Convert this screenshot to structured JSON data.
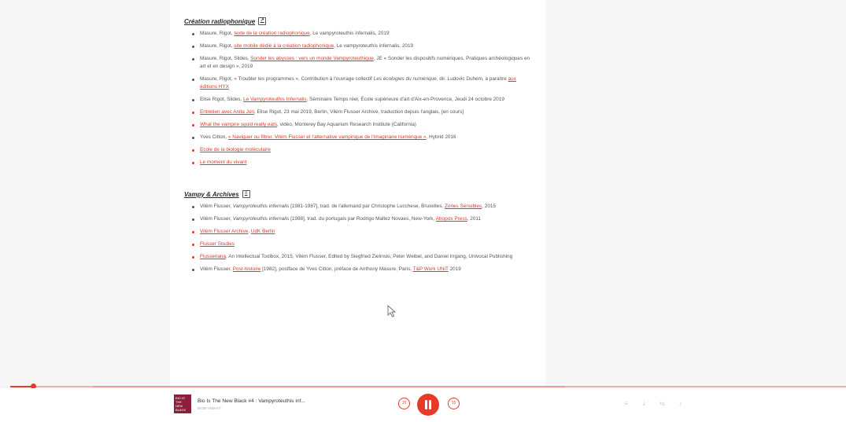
{
  "section1": {
    "title": "Création radiophonique",
    "items": [
      {
        "pre": "Masure, Rigot, ",
        "link": "texte de la création radiophonique",
        "post": ", Le vampyroteuthis infernalis, 2019"
      },
      {
        "pre": "Masure, Rigot, ",
        "link": "site mobile dédié à la création radiophonique",
        "post": ", Le vampyroteuthis infernalis, 2019"
      },
      {
        "pre": "Masure, Rigot, Slides, ",
        "link": "Sonder les abysses : vers un monde Vampyroteuthique",
        "post": ", JE « Sonder les dispositifs numériques. Pratiques archéologiques en art et en design », 2019"
      },
      {
        "pre": "Masure, Rigot, « Troubler les programmes », Contribution à l'ouvrage collectif ",
        "italic": "Les écologies du numérique",
        "mid": ", dir. Ludovic Duhem, à paraître ",
        "link": "aux éditions HYX",
        "post": ""
      },
      {
        "pre": "Elise Rigot, Slides, ",
        "link": "Le Vampyroteuthis Infernalis",
        "post": ", Séminaire Temps réel, École supérieure d'art d'Aix-en-Provence, Jeudi 24 octobre 2019"
      },
      {
        "pre": "",
        "link": "Entretien avec Anita Jori",
        "post": ", Elise Rigot, 23 mai 2019, Berlin, Vilém Flusser Archive, traduction depuis l'anglais, [en cours]"
      },
      {
        "pre": "",
        "link": "What the vampire squid really eats",
        "post": ", vidéo, Monterey Bay Aquarium Research Institute (California)"
      },
      {
        "pre": "Yves Citton, ",
        "link": "« Naviguer ou filtrer. Vilém Flusser et l'alternative vampirique de l'imaginaire numérique »",
        "post": ", Hybrid 2016"
      },
      {
        "pre": "",
        "link": "Ecole de la biologie moléculaire",
        "post": ""
      },
      {
        "pre": "",
        "link": "Le moment du vivant",
        "post": ""
      }
    ]
  },
  "section2": {
    "title": "Vampy & Archives",
    "items": [
      {
        "pre": "Vilém Flusser, ",
        "italic": "Vampyroteuthis infernalis",
        "mid": " [1981-1987], trad. de l'allemand par Christophe Lucchese, Bruxelles, ",
        "link": "Zones Sensibles",
        "post": ", 2015"
      },
      {
        "pre": "Vilém Flusser, ",
        "italic": "Vampyroteuthis infernalis",
        "mid": " [1988], trad. du portugais par Rodrigo Maltez Novaes, New-York, ",
        "link": "Atropos Press",
        "post": ", 2011"
      },
      {
        "pre": "",
        "link": "Vilém Flusser Archive",
        "post": ", ",
        "link2": "UdK Berlin"
      },
      {
        "pre": "",
        "link": "Flusser Studies",
        "post": ""
      },
      {
        "pre": "",
        "link": "Flusseriana",
        "post": ", An Intellectual Toolbox, 2015, Vilém Flusser, Edited by Siegfried Zielinski, Peter Weibel, and Daniel Irrgang, Univocal Publishing"
      },
      {
        "pre": "Vilém Flusser, ",
        "link": "Post-histoire",
        "post": " [1982], postface de Yves Citton, préface de Anthony Masure, Paris, ",
        "link2": "T&P Work UNiT",
        "post2": " 2019"
      }
    ]
  },
  "player": {
    "track_title": "Bio Is The New Black #4 : Vampyroteuthis inf...",
    "track_subtitle": "BIOB-VNM-KT",
    "cover_text": "BIO IS THE NEW BLACK",
    "rewind_label": "15",
    "forward_label": "15",
    "progress": 0.027
  },
  "colors": {
    "accent": "#e8392a",
    "link": "#d63a2a",
    "cover": "#8a1f3a"
  }
}
